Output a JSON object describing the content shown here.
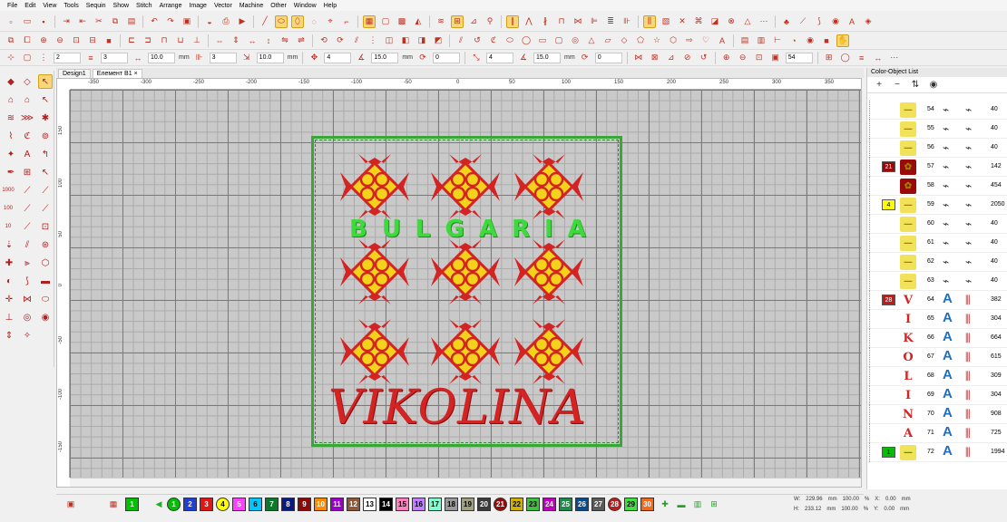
{
  "menu": [
    "File",
    "Edit",
    "View",
    "Tools",
    "Sequin",
    "Show",
    "Stitch",
    "Arrange",
    "Image",
    "Vector",
    "Machine",
    "Other",
    "Window",
    "Help"
  ],
  "toolbar3": {
    "v1": "2",
    "v2": "3",
    "len1": "10.0",
    "unit1": "mm",
    "v3": "3",
    "len2": "10.0",
    "unit2": "mm",
    "v4": "4",
    "ang1": "15.0",
    "unit3": "mm",
    "v5": "0",
    "v6": "4",
    "ang2": "15.0",
    "unit4": "mm",
    "v7": "0",
    "zoom": "54"
  },
  "tabs": [
    {
      "label": "Design1"
    },
    {
      "label": "Елемент В1"
    }
  ],
  "ruler": {
    "h": [
      "-350",
      "-300",
      "-250",
      "-200",
      "-150",
      "-100",
      "-50",
      "0",
      "50",
      "100",
      "150",
      "200",
      "250",
      "300",
      "350"
    ],
    "v": [
      "150",
      "100",
      "50",
      "0",
      "-50",
      "-100",
      "-150"
    ]
  },
  "design": {
    "text1": "BULGARIA",
    "text2": "VIKOLINA"
  },
  "panel": {
    "title": "Color-Object List"
  },
  "objects": [
    {
      "badge": "",
      "thumb": "",
      "idx": "54",
      "val": "40"
    },
    {
      "badge": "",
      "thumb": "",
      "idx": "55",
      "val": "40"
    },
    {
      "badge": "",
      "thumb": "",
      "idx": "56",
      "val": "40"
    },
    {
      "badge": "21",
      "thumb": "",
      "idx": "57",
      "val": "142"
    },
    {
      "badge": "",
      "thumb": "",
      "idx": "58",
      "val": "454"
    },
    {
      "badge": "4",
      "thumb": "",
      "idx": "59",
      "val": "2050"
    },
    {
      "badge": "",
      "thumb": "",
      "idx": "60",
      "val": "40"
    },
    {
      "badge": "",
      "thumb": "",
      "idx": "61",
      "val": "40"
    },
    {
      "badge": "",
      "thumb": "",
      "idx": "62",
      "val": "40"
    },
    {
      "badge": "",
      "thumb": "",
      "idx": "63",
      "val": "40"
    },
    {
      "badge": "28",
      "thumb": "V",
      "idx": "64",
      "val": "382"
    },
    {
      "badge": "",
      "thumb": "I",
      "idx": "65",
      "val": "304"
    },
    {
      "badge": "",
      "thumb": "K",
      "idx": "66",
      "val": "664"
    },
    {
      "badge": "",
      "thumb": "O",
      "idx": "67",
      "val": "615"
    },
    {
      "badge": "",
      "thumb": "L",
      "idx": "68",
      "val": "309"
    },
    {
      "badge": "",
      "thumb": "I",
      "idx": "69",
      "val": "304"
    },
    {
      "badge": "",
      "thumb": "N",
      "idx": "70",
      "val": "908"
    },
    {
      "badge": "",
      "thumb": "A",
      "idx": "71",
      "val": "725"
    },
    {
      "badge": "1",
      "thumb": "",
      "idx": "72",
      "val": "1994"
    }
  ],
  "palette": [
    {
      "n": "1",
      "c": "#00c000"
    },
    {
      "n": "2",
      "c": "#1f3fd0"
    },
    {
      "n": "3",
      "c": "#e01515"
    },
    {
      "n": "4",
      "c": "#ffff00"
    },
    {
      "n": "5",
      "c": "#ff40ff"
    },
    {
      "n": "6",
      "c": "#00c8ff"
    },
    {
      "n": "7",
      "c": "#0a7a2a"
    },
    {
      "n": "8",
      "c": "#0a1a80"
    },
    {
      "n": "9",
      "c": "#8a0a0a"
    },
    {
      "n": "10",
      "c": "#ff8a00"
    },
    {
      "n": "11",
      "c": "#9a00c8"
    },
    {
      "n": "12",
      "c": "#8a5a3a"
    },
    {
      "n": "13",
      "c": "#ffffff"
    },
    {
      "n": "14",
      "c": "#000000"
    },
    {
      "n": "15",
      "c": "#ff80c0"
    },
    {
      "n": "16",
      "c": "#c080ff"
    },
    {
      "n": "17",
      "c": "#80ffd0"
    },
    {
      "n": "18",
      "c": "#9a9a9a"
    },
    {
      "n": "19",
      "c": "#a0a080"
    },
    {
      "n": "20",
      "c": "#3a3a3a"
    },
    {
      "n": "21",
      "c": "#9a0a0a"
    },
    {
      "n": "22",
      "c": "#d0b000"
    },
    {
      "n": "23",
      "c": "#40c040"
    },
    {
      "n": "24",
      "c": "#c000c0"
    },
    {
      "n": "25",
      "c": "#208a4a"
    },
    {
      "n": "26",
      "c": "#0a4a8a"
    },
    {
      "n": "27",
      "c": "#5a5a5a"
    },
    {
      "n": "28",
      "c": "#c01a1a"
    },
    {
      "n": "29",
      "c": "#40e040"
    },
    {
      "n": "30",
      "c": "#f06a1a"
    }
  ],
  "coords": {
    "w_label": "W:",
    "w_val": "229.96",
    "w_unit": "mm",
    "w_pct": "100.00",
    "pct": "%",
    "h_label": "H:",
    "h_val": "233.12",
    "h_unit": "mm",
    "h_pct": "100.00",
    "x_label": "X:",
    "x_val": "0.00",
    "x_unit": "mm",
    "y_label": "Y:",
    "y_val": "0.00",
    "y_unit": "mm"
  },
  "colors": {
    "accent": "#f8d77a",
    "design_green": "#3fd83f",
    "design_red": "#d42323",
    "motif_yellow": "#f2d21a"
  }
}
